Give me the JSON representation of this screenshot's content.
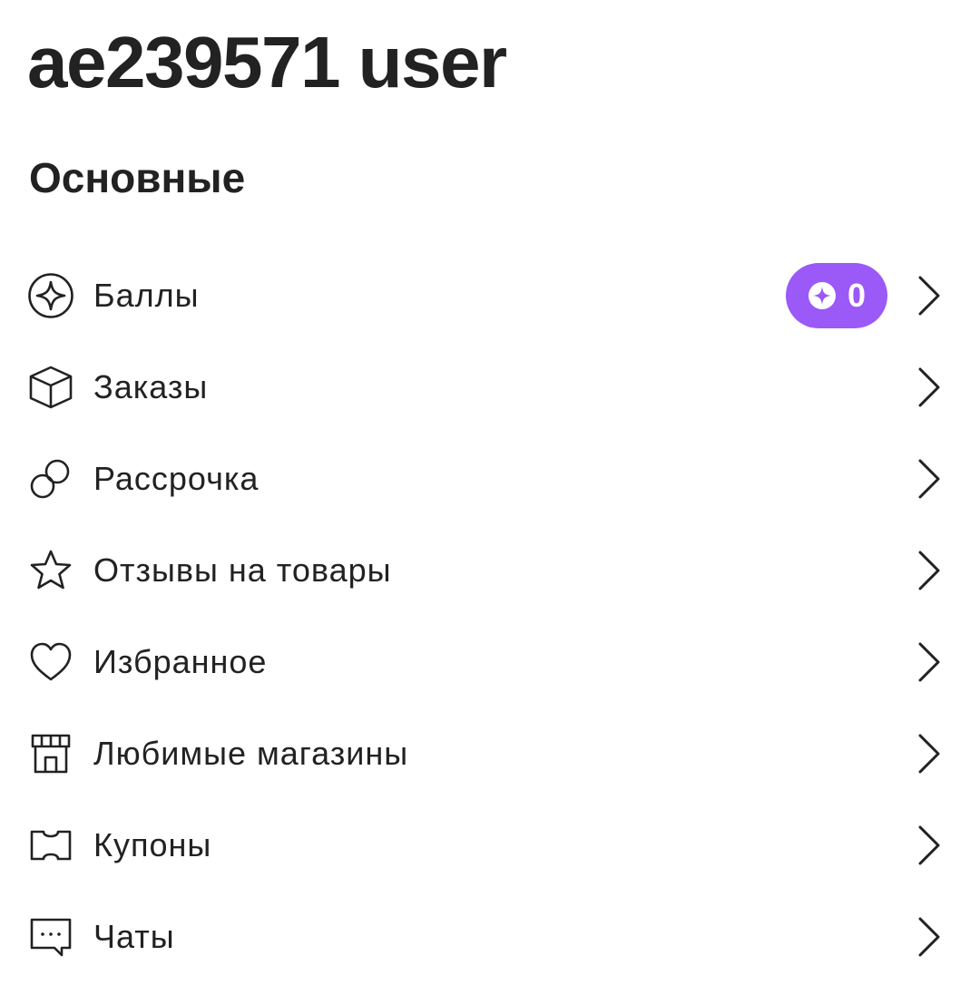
{
  "profile": {
    "username": "ae239571 user"
  },
  "section": {
    "title": "Основные"
  },
  "menu": {
    "items": [
      {
        "label": "Баллы",
        "icon": "sparkle-circle-icon"
      },
      {
        "label": "Заказы",
        "icon": "box-icon"
      },
      {
        "label": "Рассрочка",
        "icon": "installments-circles-icon"
      },
      {
        "label": "Отзывы на товары",
        "icon": "star-icon"
      },
      {
        "label": "Избранное",
        "icon": "heart-icon"
      },
      {
        "label": "Любимые магазины",
        "icon": "store-icon"
      },
      {
        "label": "Купоны",
        "icon": "coupon-icon"
      },
      {
        "label": "Чаты",
        "icon": "chat-icon"
      }
    ]
  },
  "points_badge": {
    "value": "0",
    "icon": "sparkle-icon",
    "color": "#9b59f7"
  },
  "colors": {
    "text": "#222222",
    "accent": "#9b59f7",
    "background": "#ffffff"
  }
}
